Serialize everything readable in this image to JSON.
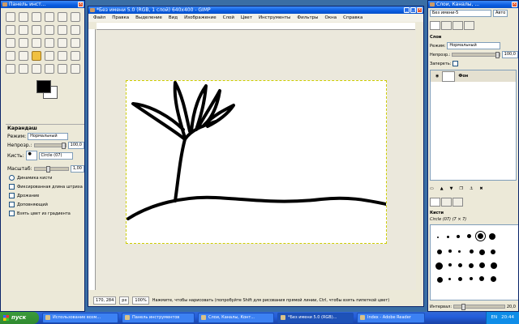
{
  "toolbox": {
    "title": "Панель инст...",
    "options_title": "Карандаш",
    "mode_label": "Режим:",
    "mode_value": "Нормальный",
    "opacity_label": "Непрозр.:",
    "opacity_value": "100,0",
    "brush_label": "Кисть:",
    "brush_value": "Circle (07)",
    "scale_label": "Масштаб:",
    "scale_value": "1,00",
    "checkboxes": [
      "Динамика кисти",
      "Фиксированная длина штриха",
      "Дрожание",
      "Доповняющий",
      "Взять цвет из градиента"
    ]
  },
  "main": {
    "title": "*Без имени 5.0 (RGB, 1 слой) 640x400 - GIMP",
    "menu": [
      "Файл",
      "Правка",
      "Выделение",
      "Вид",
      "Изображение",
      "Слой",
      "Цвет",
      "Инструменты",
      "Фильтры",
      "Окна",
      "Справка"
    ],
    "coords": "170, 284",
    "unit": "px",
    "zoom": "100%",
    "status_hint": "Нажмите, чтобы нарисовать (попробуйте Shift для рисования прямой линии, Ctrl, чтобы взять пипеткой цвет)"
  },
  "layers": {
    "title": "Слои, Каналы, ...",
    "image_select": "Без имени-5",
    "panel_title": "Слои",
    "mode_label": "Режим:",
    "mode_value": "Нормальный",
    "opacity_label": "Непрозр.:",
    "opacity_value": "100,0",
    "lock_label": "Запереть:",
    "layer_name": "Фон",
    "brushes_title": "Кисти",
    "brush_name": "Circle (07) (7 × 7)",
    "spacing_label": "Интервал:",
    "spacing_value": "20,0"
  },
  "taskbar": {
    "start": "пуск",
    "tasks": [
      "Использование возм...",
      "Панель инструментов",
      "Слои, Каналы, Конт...",
      "*Без имени 5.0 (RGB)...",
      "Index - Adobe Reader"
    ],
    "lang": "EN",
    "clock": "20:44"
  },
  "colors": {
    "accent": "#0a5ce0",
    "canvas_bg": "#ebe8dc"
  }
}
